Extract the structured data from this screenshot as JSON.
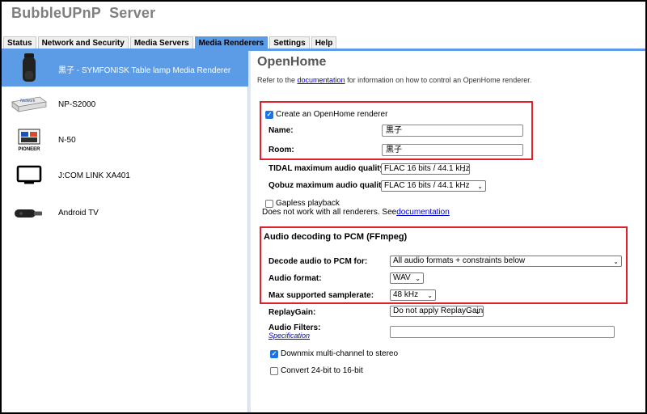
{
  "app": {
    "title": "BubbleUPnP  Server"
  },
  "tabs": [
    {
      "label": "Status"
    },
    {
      "label": "Network and Security"
    },
    {
      "label": "Media Servers"
    },
    {
      "label": "Media Renderers",
      "active": true
    },
    {
      "label": "Settings"
    },
    {
      "label": "Help"
    }
  ],
  "renderers": [
    {
      "label": "黒子 - SYMFONISK Table lamp Media Renderer",
      "icon": "speaker-lamp-icon",
      "selected": true
    },
    {
      "label": "NP-S2000",
      "icon": "network-player-icon"
    },
    {
      "label": "N-50",
      "icon": "pioneer-logo-icon",
      "icon_text": "PIONEER"
    },
    {
      "label": "J:COM LINK XA401",
      "icon": "tv-icon"
    },
    {
      "label": "Android TV",
      "icon": "chromecast-icon"
    }
  ],
  "main": {
    "heading": "OpenHome",
    "intro_prefix": "Refer to the ",
    "intro_link": "documentation",
    "intro_suffix": " for information on how to control an OpenHome renderer.",
    "create_label": "Create an OpenHome renderer",
    "name_label": "Name:",
    "name_value": "黒子",
    "room_label": "Room:",
    "room_value": "黒子",
    "tidal_label": "TIDAL maximum audio quality:",
    "tidal_value": "FLAC 16 bits / 44.1 kHz",
    "qobuz_label": "Qobuz maximum audio quality:",
    "qobuz_value": "FLAC 16 bits / 44.1 kHz",
    "gapless_label": "Gapless playback",
    "gapless_note_prefix": "Does not work with all renderers. See ",
    "gapless_note_link": "documentation",
    "decode_section": "Audio decoding to PCM (FFmpeg)",
    "decode_for_label": "Decode audio to PCM for:",
    "decode_for_value": "All audio formats + constraints below",
    "audio_format_label": "Audio format:",
    "audio_format_value": "WAV",
    "samplerate_label": "Max supported samplerate:",
    "samplerate_value": "48 kHz",
    "replaygain_label": "ReplayGain:",
    "replaygain_value": "Do not apply ReplayGain",
    "filters_label": "Audio Filters:",
    "filters_link": "Specification",
    "filters_value": "",
    "downmix_label": "Downmix multi-channel to stereo",
    "convert_label": "Convert 24-bit to 16-bit"
  },
  "colors": {
    "accent": "#5c9ce6",
    "highlight_box": "#e0202a",
    "title_gray": "#7f7f7f"
  }
}
